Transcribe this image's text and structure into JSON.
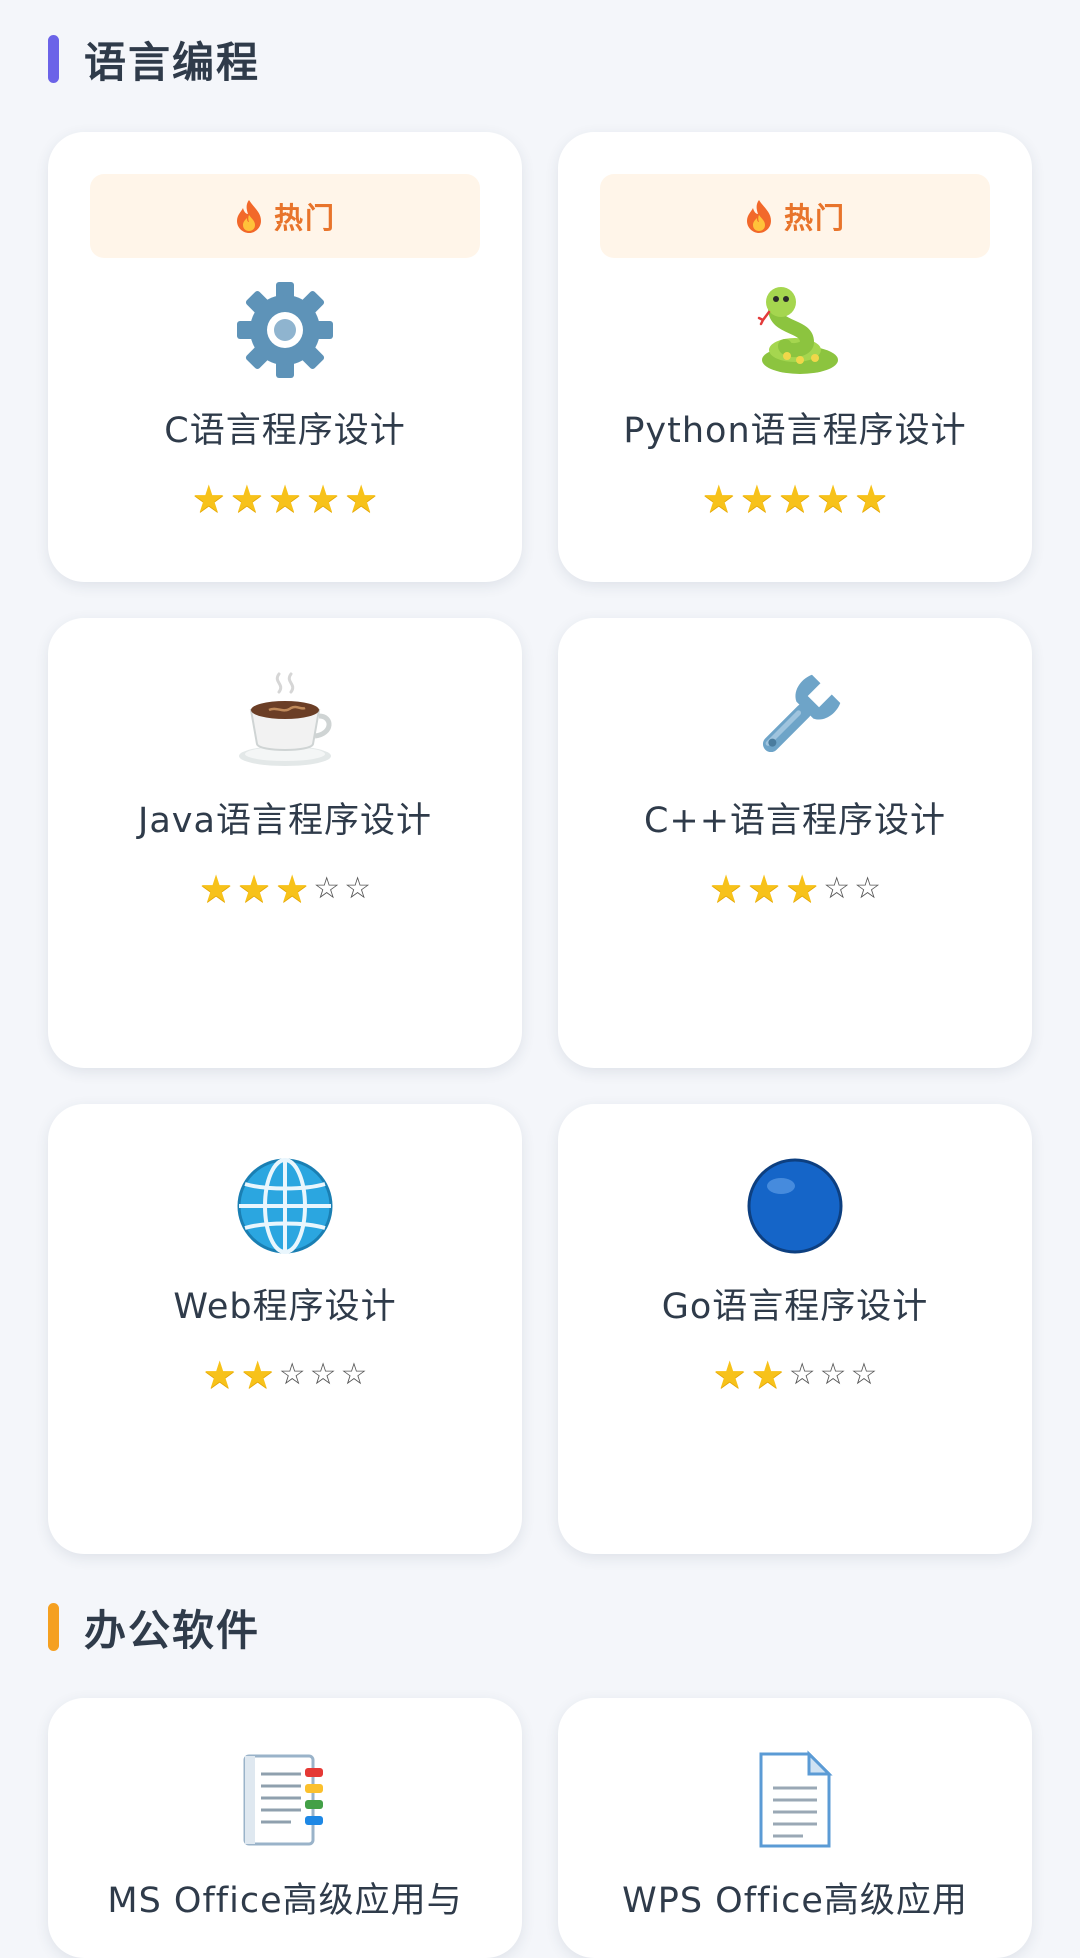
{
  "sections": [
    {
      "title": "语言编程",
      "accent": "#6b63e8"
    },
    {
      "title": "办公软件",
      "accent": "#f5a020"
    }
  ],
  "hot_label": "热门",
  "colors": {
    "hot_text": "#e8742b",
    "hot_bg": "#fff5e9",
    "star": "#f7c21a"
  },
  "courses": [
    {
      "name": "C语言程序设计",
      "icon": "gear-icon",
      "hot": true,
      "rating": 5
    },
    {
      "name": "Python语言程序设计",
      "icon": "snake-icon",
      "hot": true,
      "rating": 5
    },
    {
      "name": "Java语言程序设计",
      "icon": "coffee-icon",
      "hot": false,
      "rating": 3
    },
    {
      "name": "C++语言程序设计",
      "icon": "wrench-icon",
      "hot": false,
      "rating": 3
    },
    {
      "name": "Web程序设计",
      "icon": "globe-icon",
      "hot": false,
      "rating": 2
    },
    {
      "name": "Go语言程序设计",
      "icon": "blue-circle-icon",
      "hot": false,
      "rating": 2
    },
    {
      "name": "MS Office高级应用与",
      "icon": "notebook-icon",
      "hot": false
    },
    {
      "name": "WPS Office高级应用",
      "icon": "document-icon",
      "hot": false
    }
  ]
}
